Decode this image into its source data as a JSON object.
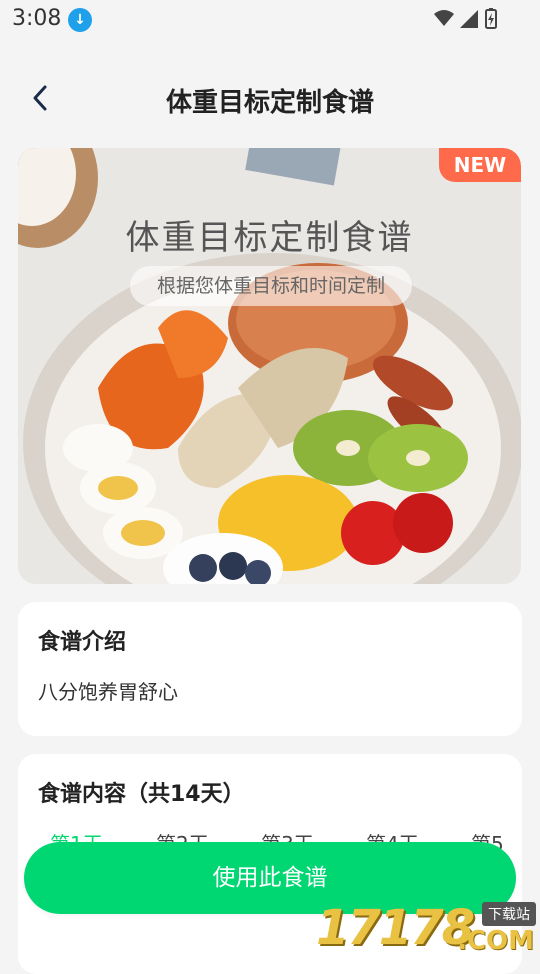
{
  "status_bar": {
    "time": "3:08",
    "icons": [
      "download-icon",
      "wifi-icon",
      "signal-icon",
      "battery-icon"
    ]
  },
  "header": {
    "title": "体重目标定制食谱",
    "back_icon": "chevron-left-icon"
  },
  "banner": {
    "badge": "NEW",
    "title": "体重目标定制食谱",
    "subtitle": "根据您体重目标和时间定制"
  },
  "intro_card": {
    "title": "食谱介绍",
    "text": "八分饱养胃舒心"
  },
  "content_card": {
    "title": "食谱内容（共14天）",
    "days": [
      "第1天",
      "第2天",
      "第3天",
      "第4天",
      "第5"
    ],
    "active_day_index": 0
  },
  "use_button": {
    "label": "使用此食谱"
  },
  "watermark": {
    "number": "17178",
    "domain": ".COM",
    "tag": "下载站"
  },
  "colors": {
    "accent": "#00d672",
    "badge": "#ff6b4a",
    "background": "#f4f4f4"
  }
}
